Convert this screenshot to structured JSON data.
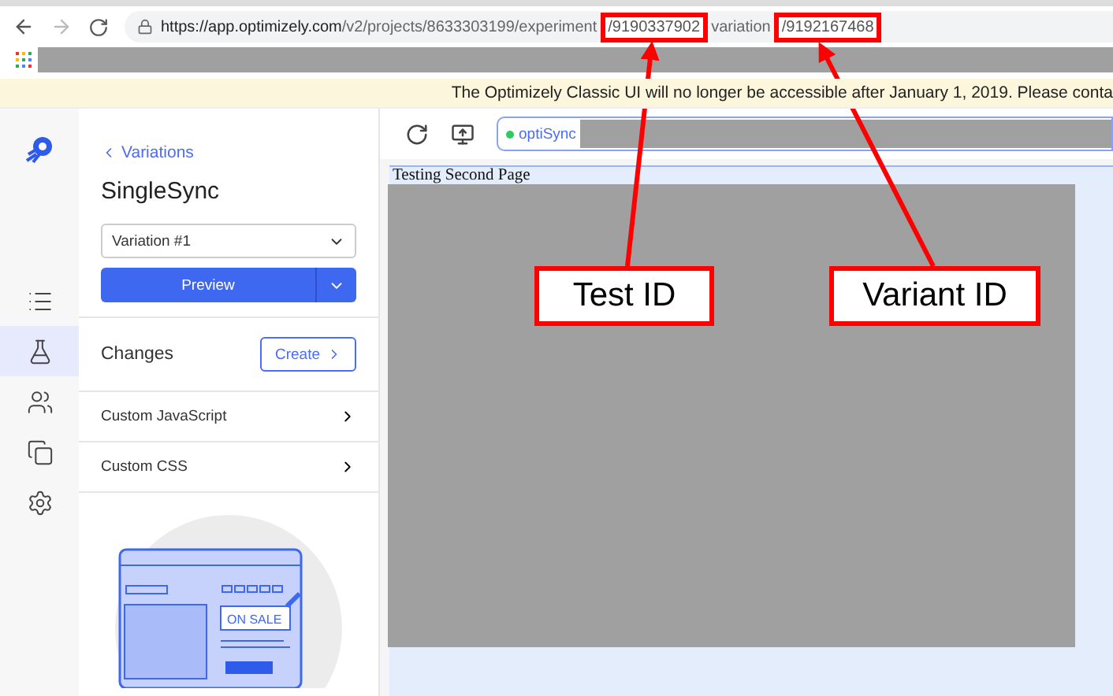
{
  "browser": {
    "url_segments": [
      {
        "text": "https://app.optimizely.com",
        "highlighted": false,
        "kind": "host"
      },
      {
        "text": "/v2/projects/8633303199/experiment",
        "highlighted": false,
        "kind": "path"
      },
      {
        "text": "/9190337902",
        "highlighted": true,
        "kind": "path"
      },
      {
        "text": "variation",
        "highlighted": false,
        "kind": "path"
      },
      {
        "text": "/9192167468",
        "highlighted": true,
        "kind": "path"
      }
    ]
  },
  "banner": {
    "text": "The Optimizely Classic UI will no longer be accessible after January 1, 2019. Please conta"
  },
  "rail": {
    "items": [
      {
        "kind": "list",
        "selected": false
      },
      {
        "kind": "flask",
        "selected": true
      },
      {
        "kind": "users",
        "selected": false
      },
      {
        "kind": "window",
        "selected": false
      },
      {
        "kind": "gear",
        "selected": false
      }
    ]
  },
  "panel": {
    "back_link": "Variations",
    "title": "SingleSync",
    "variation_select": {
      "value": "Variation #1"
    },
    "preview_button": "Preview",
    "changes": {
      "label": "Changes",
      "create_button": "Create"
    },
    "rows": [
      {
        "label": "Custom JavaScript"
      },
      {
        "label": "Custom CSS"
      }
    ],
    "illustration": {
      "badge": "ON SALE"
    }
  },
  "editor": {
    "site_tag": "optiSync",
    "page_heading": "Testing Second Page"
  },
  "annotations": [
    {
      "label": "Test ID"
    },
    {
      "label": "Variant ID"
    }
  ]
}
